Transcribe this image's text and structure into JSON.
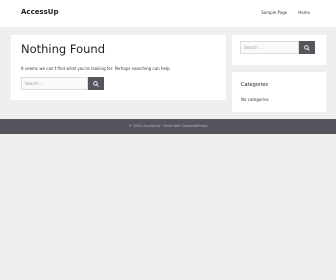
{
  "header": {
    "site_title": "AccessUp",
    "nav": [
      "Sample Page",
      "Home"
    ]
  },
  "main": {
    "title": "Nothing Found",
    "text": "It seems we can't find what you're looking for. Perhaps searching can help.",
    "search_placeholder": "Search …"
  },
  "sidebar": {
    "search_placeholder": "Search …",
    "categories_title": "Categories",
    "categories_text": "No categories"
  },
  "footer": {
    "text": "© 2021 AccessUp • Built with GeneratePress"
  },
  "colors": {
    "background": "#efefef",
    "panel": "#ffffff",
    "footer": "#55555e",
    "button": "#55555e"
  }
}
